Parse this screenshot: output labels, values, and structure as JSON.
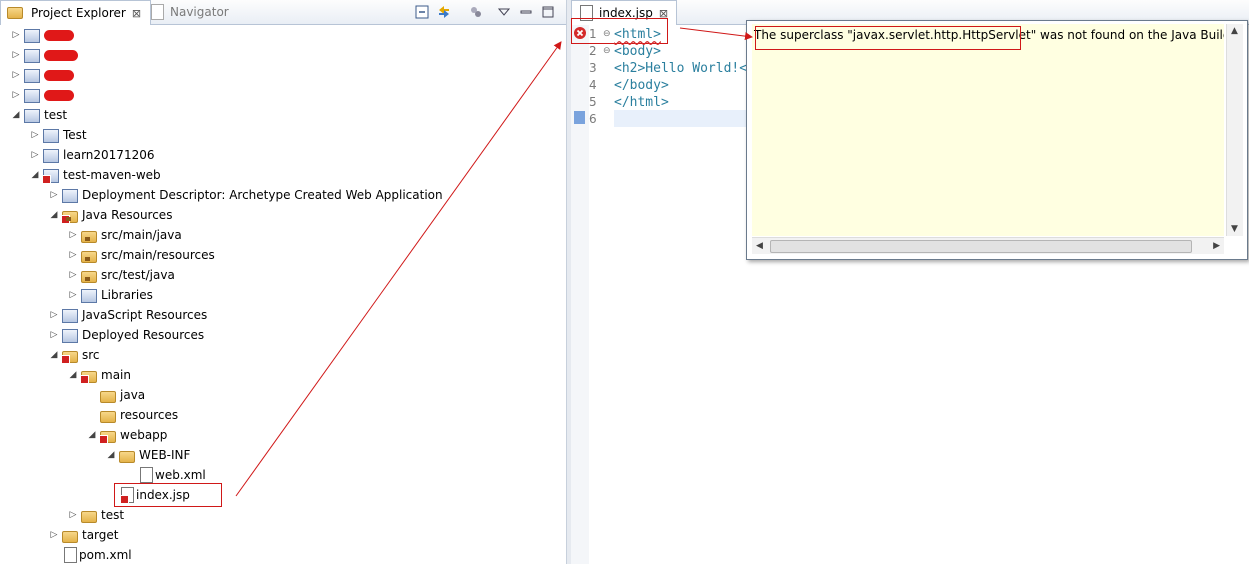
{
  "left_panel": {
    "tabs": [
      {
        "label": "Project Explorer",
        "close": "⊠",
        "active": true
      },
      {
        "label": "Navigator",
        "active": false
      }
    ]
  },
  "tree": [
    {
      "label": "",
      "indent": 0,
      "toggle": "▷",
      "icon": "project-icon",
      "redacted": true,
      "redact_width": 30
    },
    {
      "label": "",
      "indent": 0,
      "toggle": "▷",
      "icon": "project-icon",
      "redacted": true,
      "redact_width": 34
    },
    {
      "label": "",
      "indent": 0,
      "toggle": "▷",
      "icon": "project-icon",
      "redacted": true,
      "redact_width": 30
    },
    {
      "label": "",
      "indent": 0,
      "toggle": "▷",
      "icon": "project-icon",
      "redacted": true,
      "redact_width": 30
    },
    {
      "label": "test",
      "indent": 0,
      "toggle": "◢",
      "icon": "working-set-icon"
    },
    {
      "label": "Test",
      "indent": 1,
      "toggle": "▷",
      "icon": "project-icon"
    },
    {
      "label": "learn20171206",
      "indent": 1,
      "toggle": "▷",
      "icon": "maven-project-icon"
    },
    {
      "label": "test-maven-web",
      "indent": 1,
      "toggle": "◢",
      "icon": "maven-project-error-icon"
    },
    {
      "label": "Deployment Descriptor: Archetype Created Web Application",
      "indent": 2,
      "toggle": "▷",
      "icon": "deployment-descriptor-icon"
    },
    {
      "label": "Java Resources",
      "indent": 2,
      "toggle": "◢",
      "icon": "java-resources-icon"
    },
    {
      "label": "src/main/java",
      "indent": 3,
      "toggle": "▷",
      "icon": "source-folder-icon"
    },
    {
      "label": "src/main/resources",
      "indent": 3,
      "toggle": "▷",
      "icon": "source-folder-icon"
    },
    {
      "label": "src/test/java",
      "indent": 3,
      "toggle": "▷",
      "icon": "source-folder-icon"
    },
    {
      "label": "Libraries",
      "indent": 3,
      "toggle": "▷",
      "icon": "libraries-icon"
    },
    {
      "label": "JavaScript Resources",
      "indent": 2,
      "toggle": "▷",
      "icon": "javascript-resources-icon"
    },
    {
      "label": "Deployed Resources",
      "indent": 2,
      "toggle": "▷",
      "icon": "deployed-resources-icon"
    },
    {
      "label": "src",
      "indent": 2,
      "toggle": "◢",
      "icon": "folder-error-icon"
    },
    {
      "label": "main",
      "indent": 3,
      "toggle": "◢",
      "icon": "folder-error-icon"
    },
    {
      "label": "java",
      "indent": 4,
      "toggle": "",
      "icon": "folder-icon"
    },
    {
      "label": "resources",
      "indent": 4,
      "toggle": "",
      "icon": "folder-icon"
    },
    {
      "label": "webapp",
      "indent": 4,
      "toggle": "◢",
      "icon": "folder-error-icon"
    },
    {
      "label": "WEB-INF",
      "indent": 5,
      "toggle": "◢",
      "icon": "folder-icon"
    },
    {
      "label": "web.xml",
      "indent": 6,
      "toggle": "",
      "icon": "xml-file-icon"
    },
    {
      "label": "index.jsp",
      "indent": 5,
      "toggle": "",
      "icon": "jsp-file-error-icon"
    },
    {
      "label": "test",
      "indent": 3,
      "toggle": "▷",
      "icon": "folder-icon"
    },
    {
      "label": "target",
      "indent": 2,
      "toggle": "▷",
      "icon": "folder-icon"
    },
    {
      "label": "pom.xml",
      "indent": 2,
      "toggle": "",
      "icon": "pom-file-icon"
    }
  ],
  "editor": {
    "tab": {
      "label": "index.jsp",
      "close": "⊠"
    },
    "lines": [
      {
        "num": "1",
        "text": "<html>"
      },
      {
        "num": "2",
        "text": "<body>"
      },
      {
        "num": "3",
        "text": "<h2>Hello World!<"
      },
      {
        "num": "4",
        "text": "</body>"
      },
      {
        "num": "5",
        "text": "</html>"
      },
      {
        "num": "6",
        "text": ""
      }
    ]
  },
  "popup": {
    "message": "The superclass \"javax.servlet.http.HttpServlet\" was not found on the Java Build Path"
  },
  "colors": {
    "annotation_red": "#d01818",
    "tag_color": "#2a7f9e",
    "tooltip_bg": "#ffffe1"
  }
}
